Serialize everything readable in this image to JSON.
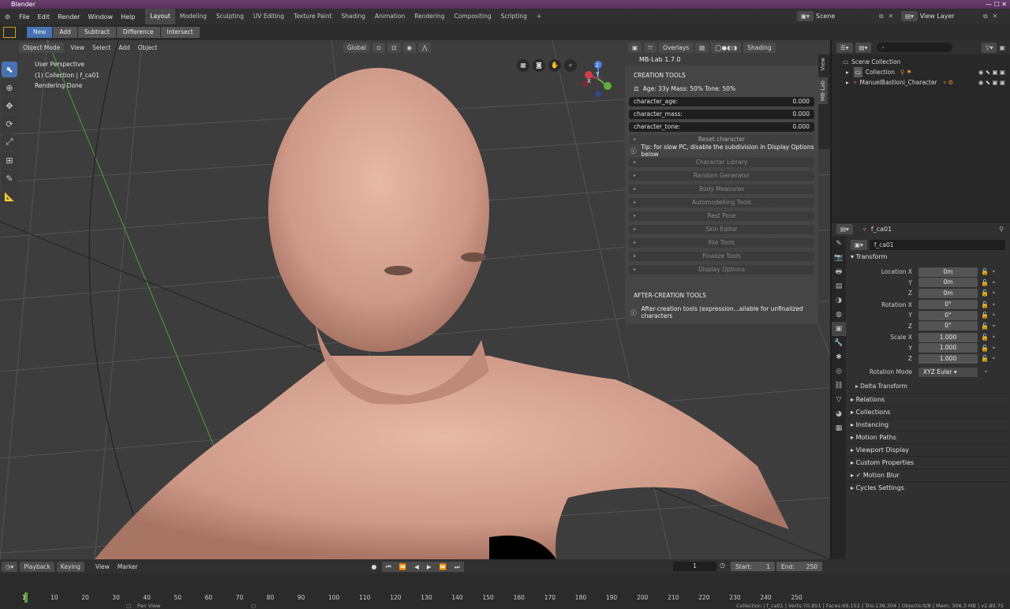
{
  "title": "Blender",
  "menus": [
    "File",
    "Edit",
    "Render",
    "Window",
    "Help"
  ],
  "workspaces": [
    "Layout",
    "Modeling",
    "Sculpting",
    "UV Editing",
    "Texture Paint",
    "Shading",
    "Animation",
    "Rendering",
    "Compositing",
    "Scripting",
    "+"
  ],
  "scene": "Scene",
  "view_layer": "View Layer",
  "bool_ops": [
    "New",
    "Add",
    "Subtract",
    "Difference",
    "Intersect"
  ],
  "viewport": {
    "mode": "Object Mode",
    "menus": [
      "View",
      "Select",
      "Add",
      "Object"
    ],
    "orientation": "Global",
    "overlays": "Overlays",
    "shading": "Shading",
    "info": [
      "User Perspective",
      "(1) Collection | f_ca01",
      "Rendering Done"
    ],
    "axes": [
      "Y",
      "X",
      "Z"
    ]
  },
  "npanel": {
    "title": "MB-Lab 1.7.0",
    "creation": "CREATION TOOLS",
    "stats": "Age: 33y  Mass: 50%  Tone: 50%",
    "fields": [
      {
        "label": "character_age:",
        "value": "0.000"
      },
      {
        "label": "character_mass:",
        "value": "0.000"
      },
      {
        "label": "character_tone:",
        "value": "0.000"
      }
    ],
    "reset": "Reset character",
    "tip": "Tip: for slow PC, disable the subdivision in Display Options below",
    "sections": [
      "Character Library",
      "Random Generator",
      "Body Measures",
      "Automodelling Tools",
      "Rest Pose",
      "Skin Editor",
      "File Tools",
      "Finalize Tools",
      "Display Options"
    ],
    "after": "AFTER-CREATION TOOLS",
    "after_tip": "After-creation tools (expression...ailable for unfinalized characters",
    "tabs": [
      "View",
      "MB-Lab"
    ]
  },
  "outliner": {
    "root": "Scene Collection",
    "collection": "Collection",
    "object": "ManuelBastioni_Character"
  },
  "props": {
    "object": "f_ca01",
    "name": "f_ca01",
    "transform": "Transform",
    "rows": [
      {
        "label": "Location X",
        "value": "0m"
      },
      {
        "label": "Y",
        "value": "0m"
      },
      {
        "label": "Z",
        "value": "0m"
      },
      {
        "label": "Rotation X",
        "value": "0°"
      },
      {
        "label": "Y",
        "value": "0°"
      },
      {
        "label": "Z",
        "value": "0°"
      },
      {
        "label": "Scale X",
        "value": "1.000"
      },
      {
        "label": "Y",
        "value": "1.000"
      },
      {
        "label": "Z",
        "value": "1.000"
      }
    ],
    "rotation_mode_label": "Rotation Mode",
    "rotation_mode": "XYZ Euler",
    "delta": "Delta Transform",
    "sections": [
      "Relations",
      "Collections",
      "Instancing",
      "Motion Paths",
      "Viewport Display",
      "Custom Properties",
      "Motion Blur",
      "Cycles Settings"
    ]
  },
  "timeline": {
    "playback": "Playback",
    "keying": "Keying",
    "view": "View",
    "marker": "Marker",
    "current": "1",
    "start_label": "Start:",
    "start": "1",
    "end_label": "End:",
    "end": "250",
    "ticks": [
      "1",
      "10",
      "20",
      "30",
      "40",
      "50",
      "60",
      "70",
      "80",
      "90",
      "100",
      "110",
      "120",
      "130",
      "140",
      "150",
      "160",
      "170",
      "180",
      "190",
      "200",
      "210",
      "220",
      "230",
      "240",
      "250"
    ]
  },
  "status": {
    "left": "Pan View",
    "right": "Collection | f_ca01 | Verts:70,851 | Faces:69,152 | Tris:138,304 | Objects:0/8 | Mem: 306.3 MB | v2.80.75"
  }
}
